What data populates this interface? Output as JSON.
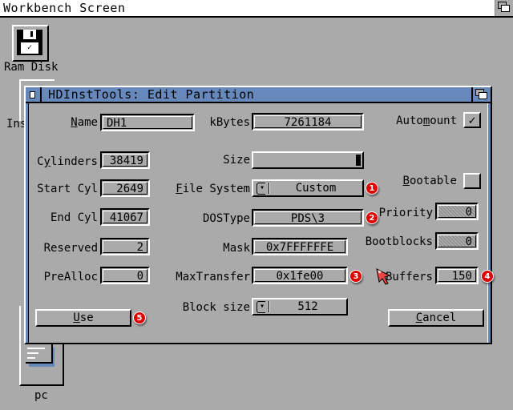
{
  "screen": {
    "title": "Workbench Screen"
  },
  "desktop": {
    "icons": [
      {
        "label": "Ram Disk",
        "icon": "floppy-disk-icon"
      },
      {
        "label": "Ins",
        "icon": "drawer-icon"
      },
      {
        "label": "pc",
        "icon": "drive-icon"
      }
    ]
  },
  "window": {
    "title": "HDInstTools: Edit Partition",
    "fields": {
      "name": {
        "label_pre": "",
        "label_u": "N",
        "label_post": "ame",
        "value": "DH1"
      },
      "kbytes": {
        "label": "kBytes",
        "value": "7261184"
      },
      "automount": {
        "label_pre": "Auto",
        "label_u": "m",
        "label_post": "ount",
        "checked": true,
        "check_glyph": "✓"
      },
      "cylinders": {
        "label_pre": "C",
        "label_u": "y",
        "label_post": "linders",
        "value": "38419"
      },
      "size": {
        "label": "Size",
        "fraction": 1.0
      },
      "start_cyl": {
        "label": "Start Cyl",
        "value": "2649"
      },
      "file_system": {
        "label_pre": "",
        "label_u": "F",
        "label_post": "ile System",
        "value": "Custom"
      },
      "bootable": {
        "label_pre": "",
        "label_u": "B",
        "label_post": "ootable",
        "checked": false,
        "check_glyph": ""
      },
      "end_cyl": {
        "label": "End Cyl",
        "value": "41067"
      },
      "dostype": {
        "label": "DOSType",
        "value": "PDS\\3"
      },
      "priority": {
        "label": "Priority",
        "value": "0",
        "disabled": true
      },
      "reserved": {
        "label": "Reserved",
        "value": "2"
      },
      "mask": {
        "label": "Mask",
        "value": "0x7FFFFFFE"
      },
      "bootblocks": {
        "label": "Bootblocks",
        "value": "0",
        "disabled": true
      },
      "prealloc": {
        "label": "PreAlloc",
        "value": "0"
      },
      "maxtransfer": {
        "label": "MaxTransfer",
        "value": "0x1fe00"
      },
      "buffers": {
        "label": "Buffers",
        "value": "150"
      },
      "block_size": {
        "label": "Block size",
        "value": "512"
      }
    },
    "buttons": {
      "use": {
        "label_u": "U",
        "label_post": "se"
      },
      "cancel": {
        "label_u": "C",
        "label_post": "ancel"
      }
    }
  },
  "annotations": [
    {
      "number": "1",
      "target": "file-system"
    },
    {
      "number": "2",
      "target": "dostype"
    },
    {
      "number": "3",
      "target": "maxtransfer"
    },
    {
      "number": "4",
      "target": "buffers"
    },
    {
      "number": "5",
      "target": "use-button"
    }
  ],
  "colors": {
    "background": "#aaaaaa",
    "title_bar": "#6688bb",
    "badge": "#e00000",
    "pointer": "#ee4444"
  }
}
